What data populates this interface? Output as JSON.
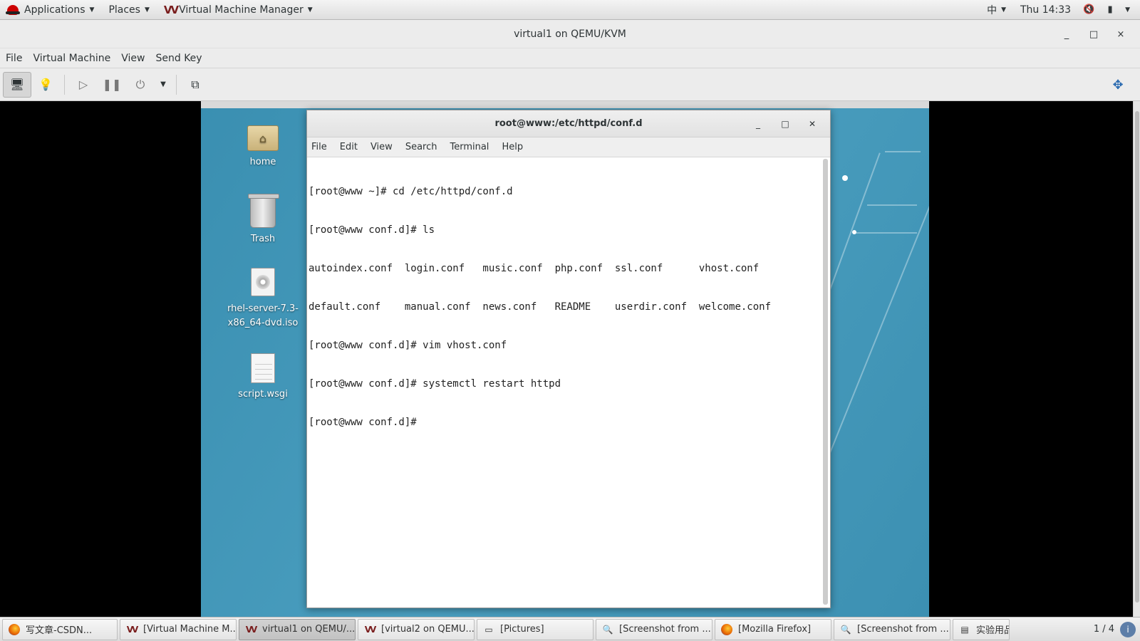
{
  "top_panel": {
    "applications": "Applications",
    "places": "Places",
    "app_name": "Virtual Machine Manager",
    "app_logo": "VV",
    "input_method": "中",
    "clock": "Thu 14:33",
    "icons": [
      "volume-icon",
      "battery-icon"
    ]
  },
  "window": {
    "title": "virtual1 on QEMU/KVM",
    "controls": {
      "minimize": "_",
      "maximize": "□",
      "close": "×"
    }
  },
  "menubar": [
    "File",
    "Virtual Machine",
    "View",
    "Send Key"
  ],
  "toolbar": {
    "icons": [
      "console-icon",
      "details-lightbulb-icon",
      "run-icon",
      "pause-icon",
      "shutdown-icon",
      "dropdown-icon",
      "snapshot-icon",
      "fullscreen-icon"
    ]
  },
  "guest": {
    "desktop_icons": [
      {
        "label": "home"
      },
      {
        "label": "Trash"
      },
      {
        "label": "rhel-server-7.3-\nx86_64-dvd.iso"
      },
      {
        "label": "script.wsgi"
      }
    ],
    "terminal": {
      "title": "root@www:/etc/httpd/conf.d",
      "menu": [
        "File",
        "Edit",
        "View",
        "Search",
        "Terminal",
        "Help"
      ],
      "lines": [
        "[root@www ~]# cd /etc/httpd/conf.d",
        "[root@www conf.d]# ls",
        "autoindex.conf  login.conf   music.conf  php.conf  ssl.conf      vhost.conf",
        "default.conf    manual.conf  news.conf   README    userdir.conf  welcome.conf",
        "[root@www conf.d]# vim vhost.conf",
        "[root@www conf.d]# systemctl restart httpd",
        "[root@www conf.d]# "
      ]
    }
  },
  "taskbar": {
    "tasks": [
      {
        "label": "写文章-CSDN...",
        "icon": "firefox-icon",
        "active": false
      },
      {
        "label": "[Virtual Machine M...",
        "icon": "vmm-icon",
        "active": false
      },
      {
        "label": "virtual1 on QEMU/...",
        "icon": "vmm-icon",
        "active": true
      },
      {
        "label": "[virtual2 on QEMU...",
        "icon": "vmm-icon",
        "active": false
      },
      {
        "label": "[Pictures]",
        "icon": "folder-icon",
        "active": false
      },
      {
        "label": "[Screenshot from ...",
        "icon": "screenshot-icon",
        "active": false
      },
      {
        "label": "[Mozilla Firefox]",
        "icon": "firefox-icon",
        "active": false
      },
      {
        "label": "[Screenshot from ...",
        "icon": "screenshot-icon",
        "active": false
      },
      {
        "label": "实验用品",
        "icon": "document-icon",
        "active": false
      }
    ],
    "pager": "1 / 4"
  }
}
